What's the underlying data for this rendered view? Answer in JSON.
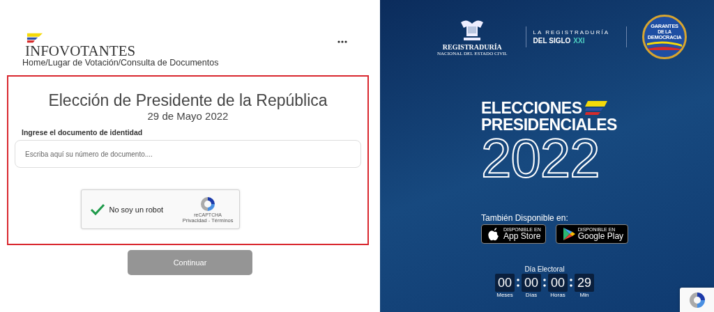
{
  "header": {
    "logo_text": "INFOVOTANTES",
    "breadcrumb": "Home/Lugar de Votación/Consulta de Documentos"
  },
  "form": {
    "title": "Elección de Presidente de la República",
    "date": "29 de Mayo 2022",
    "field_label": "Ingrese el documento de identidad",
    "document_field": {
      "placeholder": "Escriba aquí su número de documento...."
    },
    "captcha": {
      "checked": true,
      "label": "No soy un robot",
      "brand": "reCAPTCHA",
      "links": "Privacidad - Términos"
    },
    "submit": {
      "label": "Continuar",
      "disabled": true
    }
  },
  "banner": {
    "registry_logo": {
      "name": "REGISTRADURÍA",
      "subtitle": "NACIONAL DEL ESTADO CIVIL"
    },
    "slogan": {
      "line_1": "LA REGISTRADURÍA",
      "line_2": "DEL SIGLO",
      "accent": "XXI"
    },
    "seal": {
      "line_1": "GARANTES",
      "line_2": "DE LA",
      "line_3": "DEMOCRACIA"
    },
    "headline": [
      "ELECCIONES",
      "PRESIDENCIALES"
    ],
    "year": "2022",
    "available_label": "También Disponible en:",
    "stores": [
      {
        "kind": "apple",
        "caption": "DISPONIBLE EN",
        "name": "App Store"
      },
      {
        "kind": "google",
        "caption": "DISPONIBLE EN",
        "name": "Google Play"
      }
    ],
    "countdown": {
      "title": "Día Electoral",
      "units": [
        {
          "value": "00",
          "label": "Meses"
        },
        {
          "value": "00",
          "label": "Días"
        },
        {
          "value": "00",
          "label": "Horas"
        },
        {
          "value": "29",
          "label": "Min"
        }
      ]
    }
  }
}
